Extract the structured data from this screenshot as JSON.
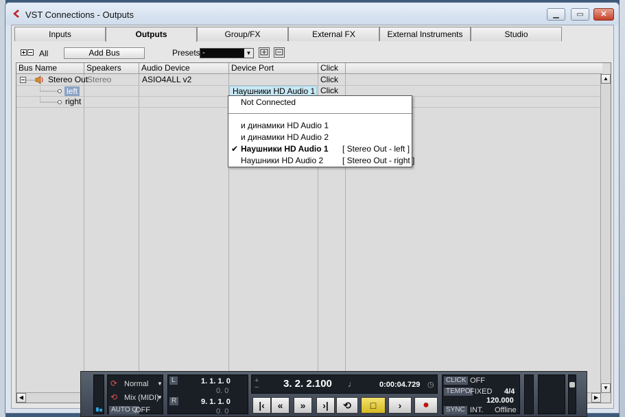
{
  "window": {
    "title": "VST Connections - Outputs"
  },
  "tabs": [
    {
      "label": "Inputs"
    },
    {
      "label": "Outputs",
      "active": true
    },
    {
      "label": "Group/FX"
    },
    {
      "label": "External FX"
    },
    {
      "label": "External Instruments"
    },
    {
      "label": "Studio"
    }
  ],
  "toolbar": {
    "all_label": "All",
    "add_bus_label": "Add Bus",
    "presets_label": "Presets",
    "presets_value": "-"
  },
  "table": {
    "headers": [
      "Bus Name",
      "Speakers",
      "Audio Device",
      "Device Port",
      "Click"
    ],
    "rows": [
      {
        "bus": "Stereo Out",
        "speakers": "Stereo",
        "device": "ASIO4ALL v2",
        "port": "",
        "click": "Click"
      },
      {
        "bus": "left",
        "speakers": "",
        "device": "",
        "port": "Наушники HD Audio 1",
        "click": ""
      },
      {
        "bus": "right",
        "speakers": "",
        "device": "",
        "port": "",
        "click": "Click"
      }
    ]
  },
  "dropdown": {
    "not_connected": "Not Connected",
    "items": [
      {
        "label": "и динамики HD Audio 1",
        "assigned": "",
        "checked": false
      },
      {
        "label": "и динамики HD Audio 2",
        "assigned": "",
        "checked": false
      },
      {
        "label": "Наушники HD Audio 1",
        "assigned": "[ Stereo Out - left ]",
        "checked": true
      },
      {
        "label": "Наушники HD Audio 2",
        "assigned": "[ Stereo Out - right ]",
        "checked": false
      }
    ]
  },
  "transport": {
    "mode": "Normal",
    "cycle_mode": "Mix (MIDI)",
    "autoq_label": "AUTO Q",
    "autoq_value": "OFF",
    "left_locator": "1. 1. 1.  0",
    "left_locator_sub": "0.  0",
    "right_locator": "9. 1. 1.  0",
    "right_locator_sub": "0.  0",
    "L": "L",
    "R": "R",
    "position_bars": "3.  2.  2.100",
    "position_time": "0:00:04.729",
    "click_label": "CLICK",
    "click_value": "OFF",
    "tempo_label": "TEMPO",
    "tempo_mode": "FIXED",
    "signature": "4/4",
    "tempo_value": "120.000",
    "sync_label": "SYNC",
    "sync_mode": "INT.",
    "sync_status": "Offline"
  },
  "colors": {
    "accent_selection": "#8ba3c4",
    "port_highlight": "#c8e8f4",
    "stop_button": "#d4b822",
    "record_button": "#c01010"
  }
}
